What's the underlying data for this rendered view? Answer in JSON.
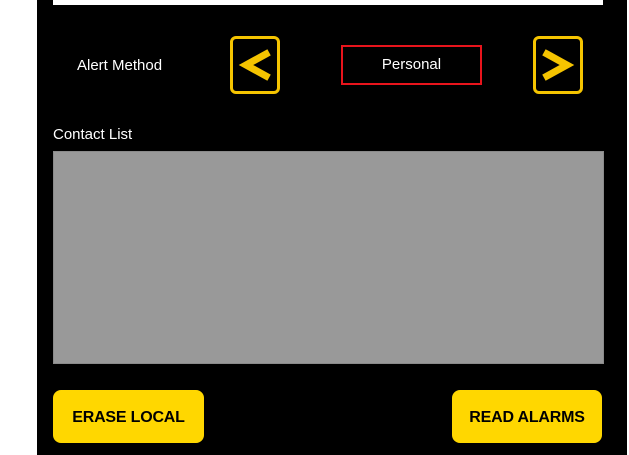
{
  "alert": {
    "label": "Alert Method",
    "current_method": "Personal"
  },
  "navigation": {
    "prev_icon": "chevron-left-icon",
    "next_icon": "chevron-right-icon"
  },
  "contacts": {
    "label": "Contact List",
    "items": []
  },
  "actions": {
    "erase_label": "ERASE LOCAL",
    "read_label": "READ ALARMS"
  },
  "colors": {
    "background": "#000000",
    "accent_yellow": "#ffd700",
    "selection_border": "#e8141c",
    "list_background": "#999999"
  }
}
